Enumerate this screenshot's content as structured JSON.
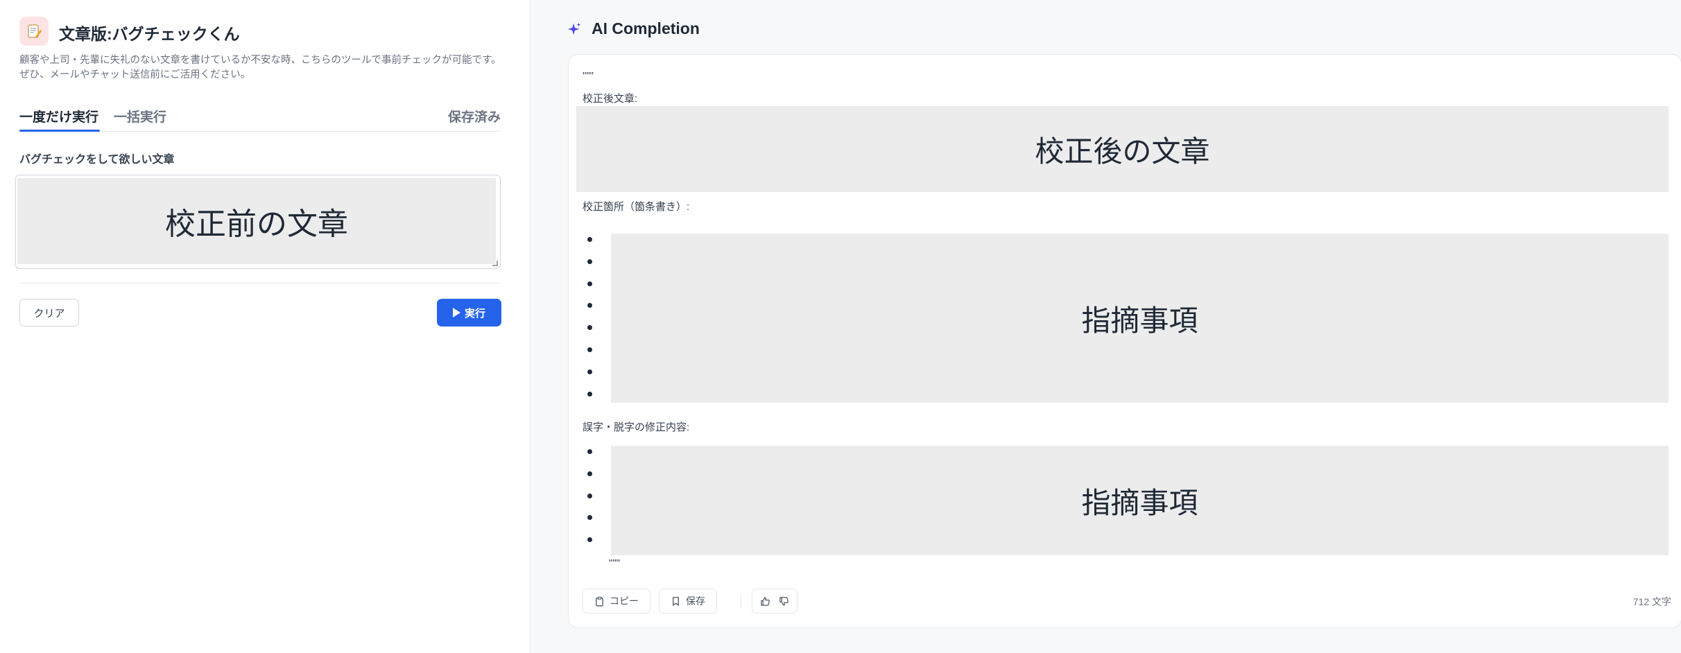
{
  "app": {
    "icon": "memo-icon",
    "title": "文章版:バグチェックくん",
    "description_line1": "顧客や上司・先輩に失礼のない文章を書けているか不安な時、こちらのツールで事前チェックが可能です。",
    "description_line2": "ぜひ、メールやチャット送信前にご活用ください。"
  },
  "tabs": {
    "once": "一度だけ実行",
    "batch": "一括実行",
    "saved": "保存済み",
    "active": "once"
  },
  "input": {
    "label": "バグチェックをして欲しい文章",
    "redaction_label": "校正前の文章"
  },
  "buttons": {
    "clear": "クリア",
    "run": "実行"
  },
  "completion": {
    "title": "AI Completion",
    "open_quote": "\"\"\"",
    "section1_label": "校正後文章:",
    "section1_redaction": "校正後の文章",
    "section2_label": "校正箇所（箇条書き）:",
    "section2_redaction": "指摘事項",
    "section2_bullets": 8,
    "section3_label": "誤字・脱字の修正内容:",
    "section3_redaction": "指摘事項",
    "section3_bullets": 5,
    "close_quote": "\"\"\""
  },
  "footer": {
    "copy": "コピー",
    "save": "保存",
    "char_count": "712 文字"
  },
  "colors": {
    "accent": "#2563eb",
    "redaction": "#ececec",
    "sparkle": "#4f46e5"
  }
}
